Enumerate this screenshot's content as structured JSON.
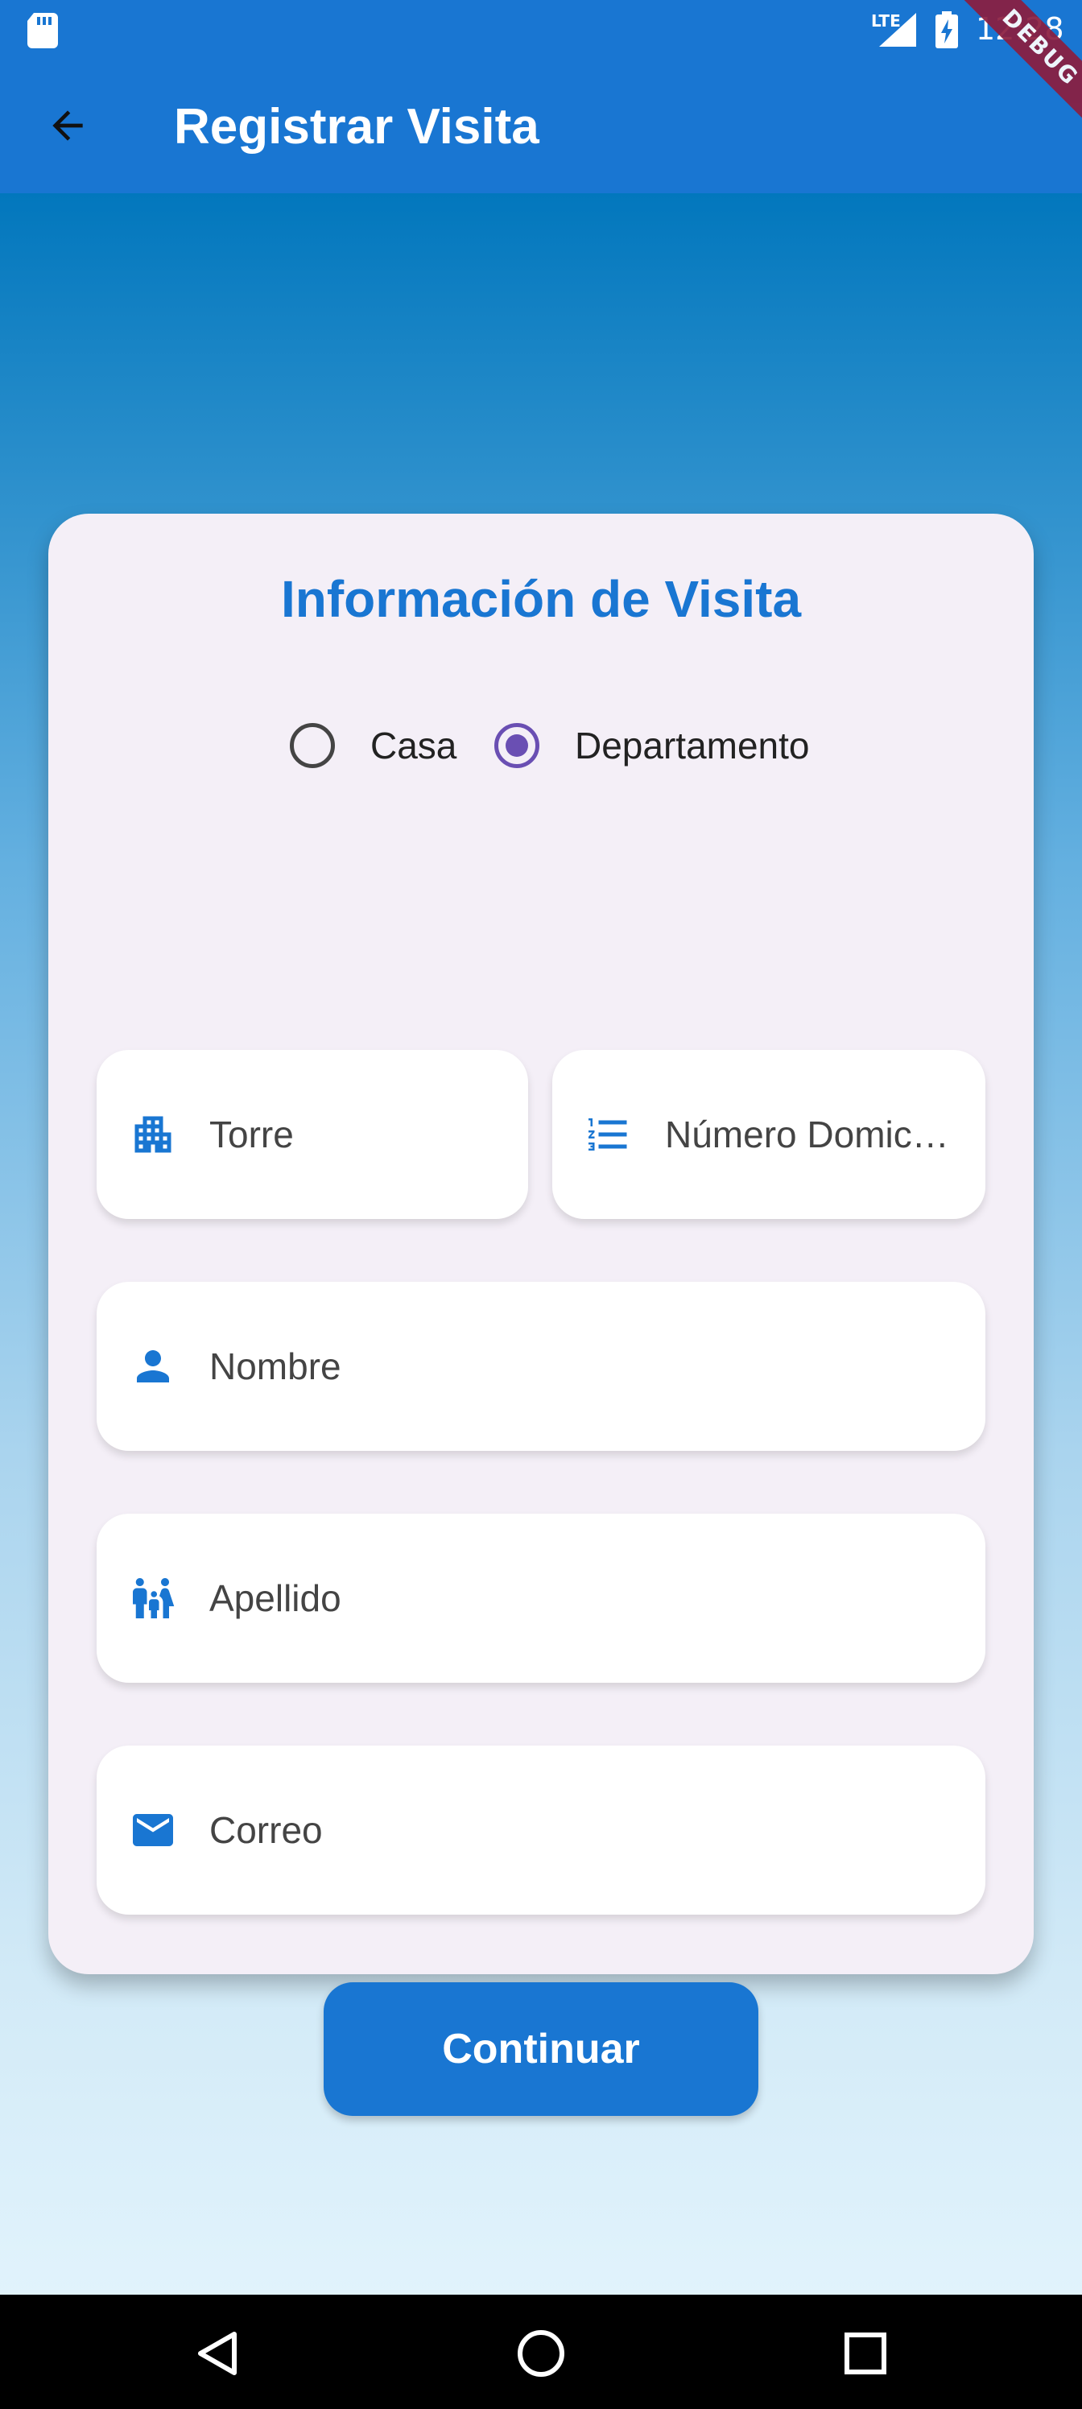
{
  "status_bar": {
    "network": "LTE",
    "time": "12:28",
    "debug_banner": "DEBUG"
  },
  "app_bar": {
    "title": "Registrar Visita",
    "back_icon": "arrow-back-icon"
  },
  "form": {
    "title": "Información de Visita",
    "type_options": [
      {
        "label": "Casa",
        "selected": false
      },
      {
        "label": "Departamento",
        "selected": true
      }
    ],
    "fields": {
      "torre": {
        "placeholder": "Torre",
        "icon": "building-icon"
      },
      "numero": {
        "placeholder": "Número Domicilio",
        "icon": "numbered-list-icon"
      },
      "nombre": {
        "placeholder": "Nombre",
        "icon": "person-icon"
      },
      "apellido": {
        "placeholder": "Apellido",
        "icon": "family-icon"
      },
      "correo": {
        "placeholder": "Correo",
        "icon": "email-icon"
      }
    },
    "submit_label": "Continuar"
  },
  "colors": {
    "primary": "#1976d2",
    "radio_selected": "#6a4fb3",
    "card_bg": "#f4eff7"
  },
  "nav_bar": {
    "back": "triangle-back-icon",
    "home": "circle-home-icon",
    "recents": "square-recents-icon"
  }
}
